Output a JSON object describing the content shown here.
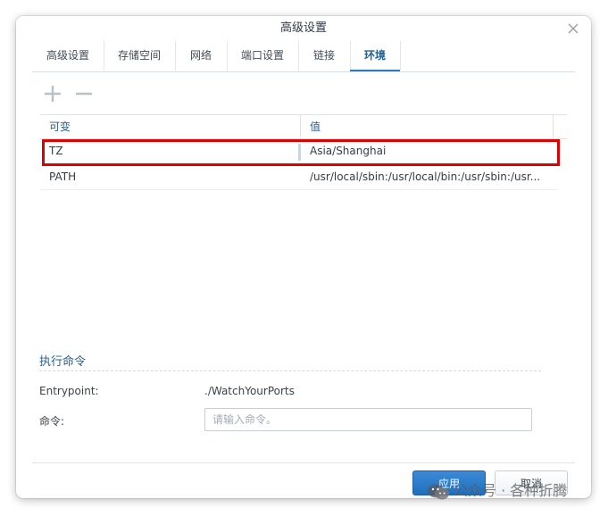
{
  "dialog": {
    "title": "高级设置",
    "close_icon": "close-icon"
  },
  "tabs": [
    {
      "label": "高级设置",
      "active": false
    },
    {
      "label": "存储空间",
      "active": false
    },
    {
      "label": "网络",
      "active": false
    },
    {
      "label": "端口设置",
      "active": false
    },
    {
      "label": "链接",
      "active": false
    },
    {
      "label": "环境",
      "active": true
    }
  ],
  "toolbar": {
    "add_icon": "plus-icon",
    "remove_icon": "minus-icon"
  },
  "env_table": {
    "columns": [
      "可变",
      "值"
    ],
    "rows": [
      {
        "name": "TZ",
        "value": "Asia/Shanghai"
      },
      {
        "name": "PATH",
        "value": "/usr/local/sbin:/usr/local/bin:/usr/sbin:/usr..."
      }
    ]
  },
  "exec_section": {
    "title": "执行命令",
    "entrypoint_label": "Entrypoint:",
    "entrypoint_value": "./WatchYourPorts",
    "command_label": "命令:",
    "command_placeholder": "请输入命令。",
    "command_value": ""
  },
  "footer": {
    "apply_label": "应用",
    "cancel_label": "取消"
  },
  "watermark": {
    "text": "公众号 · 各种折腾",
    "icon": "wechat-icon"
  },
  "colors": {
    "accent": "#2f7cc1",
    "highlight_border": "#e00000",
    "apply_button": "#2a7bcf"
  }
}
